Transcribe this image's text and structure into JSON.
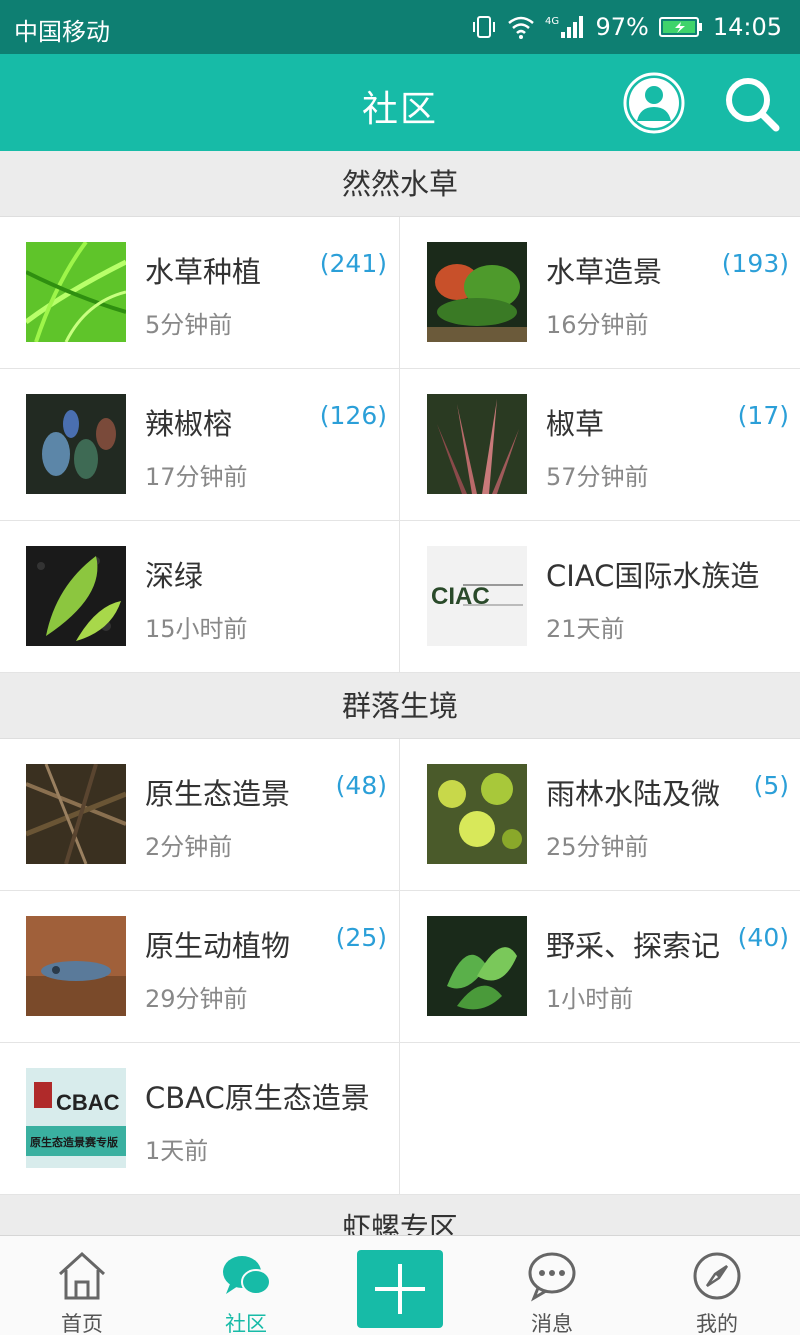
{
  "status": {
    "carrier": "中国移动",
    "network": "4G",
    "battery": "97%",
    "time": "14:05"
  },
  "header": {
    "title": "社区",
    "avatar_icon": "user-avatar-icon",
    "search_icon": "search-icon"
  },
  "sections": [
    {
      "title": "然然水草",
      "forums": [
        {
          "name": "水草种植",
          "count": "(241)",
          "time": "5分钟前"
        },
        {
          "name": "水草造景",
          "count": "(193)",
          "time": "16分钟前"
        },
        {
          "name": "辣椒榕",
          "count": "(126)",
          "time": "17分钟前"
        },
        {
          "name": "椒草",
          "count": "(17)",
          "time": "57分钟前"
        },
        {
          "name": "深绿",
          "count": "",
          "time": "15小时前"
        },
        {
          "name": "CIAC国际水族造",
          "count": "",
          "time": "21天前"
        }
      ]
    },
    {
      "title": "群落生境",
      "forums": [
        {
          "name": "原生态造景",
          "count": "(48)",
          "time": "2分钟前"
        },
        {
          "name": "雨林水陆及微",
          "count": "(5)",
          "time": "25分钟前"
        },
        {
          "name": "原生动植物",
          "count": "(25)",
          "time": "29分钟前"
        },
        {
          "name": "野采、探索记",
          "count": "(40)",
          "time": "1小时前"
        },
        {
          "name": "CBAC原生态造景",
          "count": "",
          "time": "1天前"
        }
      ]
    },
    {
      "title": "虾螺专区"
    }
  ],
  "thumb_text": {
    "ciac": "CIAC",
    "cbac": "CBAC",
    "cbac_sub": "原生态造景赛专版"
  },
  "tabbar": {
    "home": "首页",
    "community": "社区",
    "messages": "消息",
    "mine": "我的"
  },
  "colors": {
    "brand": "#17bba7",
    "status_bar": "#0e7f72",
    "count": "#2b9fd8"
  }
}
